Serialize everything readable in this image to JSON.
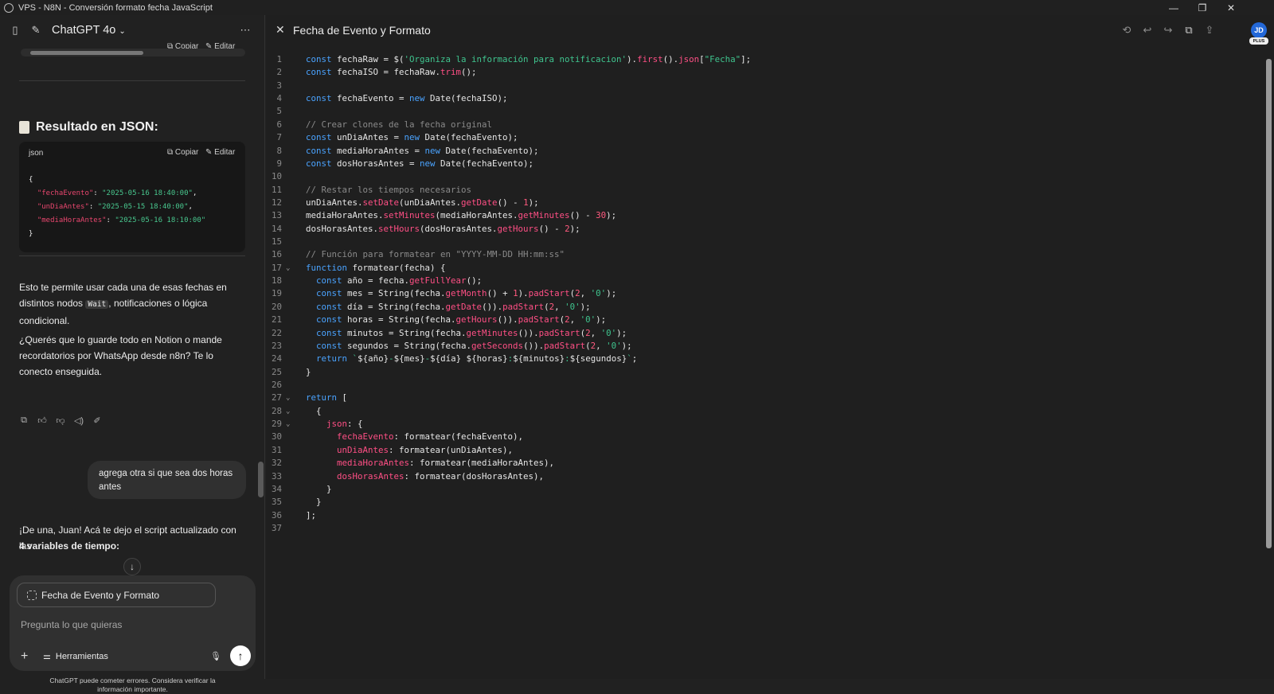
{
  "window": {
    "title": "VPS - N8N - Conversión formato fecha JavaScript"
  },
  "sidebar": {
    "model_label": "ChatGPT 4o",
    "top_actions": {
      "copy": "Copiar",
      "edit": "Editar"
    },
    "json_heading": "Resultado en JSON:",
    "json_block": {
      "lang": "json",
      "copy_label": "Copiar",
      "edit_label": "Editar",
      "lines": [
        {
          "key": "",
          "value": "",
          "raw": "{"
        },
        {
          "key": "\"fechaEvento\"",
          "value": "\"2025-05-16 18:40:00\"",
          "suffix": ","
        },
        {
          "key": "\"unDiaAntes\"",
          "value": "\"2025-05-15 18:40:00\"",
          "suffix": ","
        },
        {
          "key": "\"mediaHoraAntes\"",
          "value": "\"2025-05-16 18:10:00\"",
          "suffix": ""
        },
        {
          "key": "",
          "value": "",
          "raw": "}"
        }
      ]
    },
    "para1": {
      "before": "Esto te permite usar cada una de esas fechas en distintos nodos ",
      "code": "Wait",
      "after": ", notificaciones o lógica condicional."
    },
    "para2": "¿Querés que lo guarde todo en Notion o mande recordatorios por WhatsApp desde n8n? Te lo conecto enseguida.",
    "user_message": "agrega otra si que sea dos horas antes",
    "reply_line1": "¡De una, Juan! Acá te dejo el script actualizado con las",
    "reply_line2": "4 variables de tiempo:",
    "composer": {
      "chip_label": "Fecha de Evento y Formato",
      "placeholder": "Pregunta lo que quieras",
      "tools_label": "Herramientas"
    },
    "disclaimer": "ChatGPT puede cometer errores. Considera verificar la información importante."
  },
  "canvas": {
    "title": "Fecha de Evento y Formato",
    "avatar_initials": "JD",
    "avatar_badge": "PLUS",
    "code_lines": [
      [
        [
          "kw",
          "const"
        ],
        [
          "t",
          " fechaRaw = $("
        ],
        [
          "str",
          "'Organiza la información para notificacion'"
        ],
        [
          "t",
          ")."
        ],
        [
          "fn",
          "first"
        ],
        [
          "t",
          "()."
        ],
        [
          "fn",
          "json"
        ],
        [
          "t",
          "["
        ],
        [
          "str",
          "\"Fecha\""
        ],
        [
          "t",
          "];"
        ]
      ],
      [
        [
          "kw",
          "const"
        ],
        [
          "t",
          " fechaISO = fechaRaw."
        ],
        [
          "fn",
          "trim"
        ],
        [
          "t",
          "();"
        ]
      ],
      [],
      [
        [
          "kw",
          "const"
        ],
        [
          "t",
          " fechaEvento = "
        ],
        [
          "kw",
          "new"
        ],
        [
          "t",
          " Date(fechaISO);"
        ]
      ],
      [],
      [
        [
          "com",
          "// Crear clones de la fecha original"
        ]
      ],
      [
        [
          "kw",
          "const"
        ],
        [
          "t",
          " unDiaAntes = "
        ],
        [
          "kw",
          "new"
        ],
        [
          "t",
          " Date(fechaEvento);"
        ]
      ],
      [
        [
          "kw",
          "const"
        ],
        [
          "t",
          " mediaHoraAntes = "
        ],
        [
          "kw",
          "new"
        ],
        [
          "t",
          " Date(fechaEvento);"
        ]
      ],
      [
        [
          "kw",
          "const"
        ],
        [
          "t",
          " dosHorasAntes = "
        ],
        [
          "kw",
          "new"
        ],
        [
          "t",
          " Date(fechaEvento);"
        ]
      ],
      [],
      [
        [
          "com",
          "// Restar los tiempos necesarios"
        ]
      ],
      [
        [
          "t",
          "unDiaAntes."
        ],
        [
          "fn",
          "setDate"
        ],
        [
          "t",
          "(unDiaAntes."
        ],
        [
          "fn",
          "getDate"
        ],
        [
          "t",
          "() - "
        ],
        [
          "num",
          "1"
        ],
        [
          "t",
          ");"
        ]
      ],
      [
        [
          "t",
          "mediaHoraAntes."
        ],
        [
          "fn",
          "setMinutes"
        ],
        [
          "t",
          "(mediaHoraAntes."
        ],
        [
          "fn",
          "getMinutes"
        ],
        [
          "t",
          "() - "
        ],
        [
          "num",
          "30"
        ],
        [
          "t",
          ");"
        ]
      ],
      [
        [
          "t",
          "dosHorasAntes."
        ],
        [
          "fn",
          "setHours"
        ],
        [
          "t",
          "(dosHorasAntes."
        ],
        [
          "fn",
          "getHours"
        ],
        [
          "t",
          "() - "
        ],
        [
          "num",
          "2"
        ],
        [
          "t",
          ");"
        ]
      ],
      [],
      [
        [
          "com",
          "// Función para formatear en \"YYYY-MM-DD HH:mm:ss\""
        ]
      ],
      [
        [
          "kw",
          "function"
        ],
        [
          "t",
          " formatear(fecha) {"
        ]
      ],
      [
        [
          "t",
          "  "
        ],
        [
          "kw",
          "const"
        ],
        [
          "t",
          " año = fecha."
        ],
        [
          "fn",
          "getFullYear"
        ],
        [
          "t",
          "();"
        ]
      ],
      [
        [
          "t",
          "  "
        ],
        [
          "kw",
          "const"
        ],
        [
          "t",
          " mes = String(fecha."
        ],
        [
          "fn",
          "getMonth"
        ],
        [
          "t",
          "() + "
        ],
        [
          "num",
          "1"
        ],
        [
          "t",
          ")."
        ],
        [
          "fn",
          "padStart"
        ],
        [
          "t",
          "("
        ],
        [
          "num",
          "2"
        ],
        [
          "t",
          ", "
        ],
        [
          "str",
          "'0'"
        ],
        [
          "t",
          ");"
        ]
      ],
      [
        [
          "t",
          "  "
        ],
        [
          "kw",
          "const"
        ],
        [
          "t",
          " día = String(fecha."
        ],
        [
          "fn",
          "getDate"
        ],
        [
          "t",
          "())."
        ],
        [
          "fn",
          "padStart"
        ],
        [
          "t",
          "("
        ],
        [
          "num",
          "2"
        ],
        [
          "t",
          ", "
        ],
        [
          "str",
          "'0'"
        ],
        [
          "t",
          ");"
        ]
      ],
      [
        [
          "t",
          "  "
        ],
        [
          "kw",
          "const"
        ],
        [
          "t",
          " horas = String(fecha."
        ],
        [
          "fn",
          "getHours"
        ],
        [
          "t",
          "())."
        ],
        [
          "fn",
          "padStart"
        ],
        [
          "t",
          "("
        ],
        [
          "num",
          "2"
        ],
        [
          "t",
          ", "
        ],
        [
          "str",
          "'0'"
        ],
        [
          "t",
          ");"
        ]
      ],
      [
        [
          "t",
          "  "
        ],
        [
          "kw",
          "const"
        ],
        [
          "t",
          " minutos = String(fecha."
        ],
        [
          "fn",
          "getMinutes"
        ],
        [
          "t",
          "())."
        ],
        [
          "fn",
          "padStart"
        ],
        [
          "t",
          "("
        ],
        [
          "num",
          "2"
        ],
        [
          "t",
          ", "
        ],
        [
          "str",
          "'0'"
        ],
        [
          "t",
          ");"
        ]
      ],
      [
        [
          "t",
          "  "
        ],
        [
          "kw",
          "const"
        ],
        [
          "t",
          " segundos = String(fecha."
        ],
        [
          "fn",
          "getSeconds"
        ],
        [
          "t",
          "())."
        ],
        [
          "fn",
          "padStart"
        ],
        [
          "t",
          "("
        ],
        [
          "num",
          "2"
        ],
        [
          "t",
          ", "
        ],
        [
          "str",
          "'0'"
        ],
        [
          "t",
          ");"
        ]
      ],
      [
        [
          "t",
          "  "
        ],
        [
          "kw",
          "return"
        ],
        [
          "t",
          " "
        ],
        [
          "str",
          "`"
        ],
        [
          "t",
          "${año}"
        ],
        [
          "str",
          "-"
        ],
        [
          "t",
          "${mes}"
        ],
        [
          "str",
          "-"
        ],
        [
          "t",
          "${día} ${horas}"
        ],
        [
          "str",
          ":"
        ],
        [
          "t",
          "${minutos}"
        ],
        [
          "str",
          ":"
        ],
        [
          "t",
          "${segundos}"
        ],
        [
          "str",
          "`"
        ],
        [
          "t",
          ";"
        ]
      ],
      [
        [
          "t",
          "}"
        ]
      ],
      [],
      [
        [
          "kw",
          "return"
        ],
        [
          "t",
          " ["
        ]
      ],
      [
        [
          "t",
          "  {"
        ]
      ],
      [
        [
          "t",
          "    "
        ],
        [
          "prop",
          "json"
        ],
        [
          "t",
          ": {"
        ]
      ],
      [
        [
          "t",
          "      "
        ],
        [
          "prop",
          "fechaEvento"
        ],
        [
          "t",
          ": formatear(fechaEvento),"
        ]
      ],
      [
        [
          "t",
          "      "
        ],
        [
          "prop",
          "unDiaAntes"
        ],
        [
          "t",
          ": formatear(unDiaAntes),"
        ]
      ],
      [
        [
          "t",
          "      "
        ],
        [
          "prop",
          "mediaHoraAntes"
        ],
        [
          "t",
          ": formatear(mediaHoraAntes),"
        ]
      ],
      [
        [
          "t",
          "      "
        ],
        [
          "prop",
          "dosHorasAntes"
        ],
        [
          "t",
          ": formatear(dosHorasAntes),"
        ]
      ],
      [
        [
          "t",
          "    }"
        ]
      ],
      [
        [
          "t",
          "  }"
        ]
      ],
      [
        [
          "t",
          "];"
        ]
      ],
      []
    ],
    "fold_lines": [
      17,
      27,
      28,
      29
    ]
  }
}
